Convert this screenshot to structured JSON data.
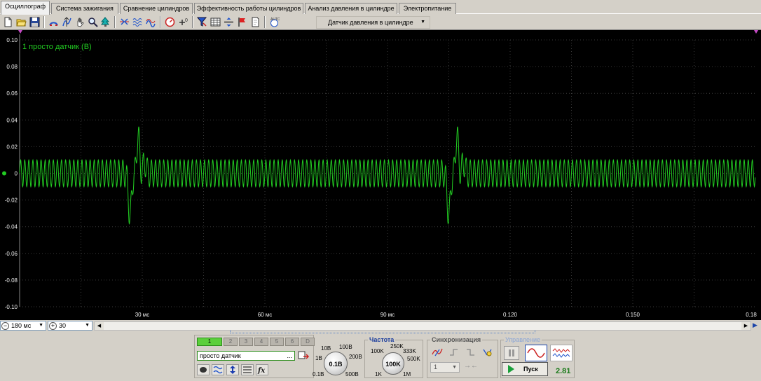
{
  "tabs": [
    {
      "label": "Осциллограф",
      "active": true
    },
    {
      "label": "Система зажигания",
      "active": false
    },
    {
      "label": "Сравнение цилиндров",
      "active": false
    },
    {
      "label": "Эффективность работы цилиндров",
      "active": false
    },
    {
      "label": "Анализ давления в цилиндре",
      "active": false
    },
    {
      "label": "Электропитание",
      "active": false
    }
  ],
  "toolbar": {
    "icons": [
      "new-file-icon",
      "open-folder-icon",
      "save-icon",
      "rotate-icon",
      "timing-icon",
      "hand-icon",
      "zoom-icon",
      "trigger-tree-icon",
      "markers-icon",
      "overlay-waves-icon",
      "waves-multi-icon",
      "gauge-auto-icon",
      "offset-zero-icon",
      "filter-icon",
      "table-icon",
      "divide-icon",
      "flag-icon",
      "note-icon",
      "auto-icon"
    ],
    "sensor_select": "Датчик давления в цилиндре"
  },
  "chart_data": {
    "type": "line",
    "series": [
      {
        "name": "1 просто датчик (В)",
        "color": "#22cc22"
      }
    ],
    "ylim": [
      -0.1,
      0.1
    ],
    "yticks": [
      "0.10",
      "0.08",
      "0.06",
      "0.04",
      "0.02",
      "0",
      "-0.02",
      "-0.04",
      "-0.06",
      "-0.08",
      "-0.10"
    ],
    "xlim_ms": [
      0,
      180
    ],
    "xticks": [
      "30 мс",
      "60 мс",
      "90 мс",
      "0.120",
      "0.150",
      "0.18"
    ],
    "xtick_values_ms": [
      30,
      60,
      90,
      120,
      150,
      180
    ],
    "description_values": {
      "baseline_amplitude": 0.01,
      "baseline_period_ms": 1.0,
      "event_times_ms": [
        28,
        106
      ],
      "event_peak": 0.036,
      "event_trough": -0.038
    }
  },
  "status": {
    "timebase": "180 мс",
    "samples": "30"
  },
  "channels": {
    "buttons": [
      "1",
      "2",
      "3",
      "4",
      "5",
      "6",
      "D"
    ],
    "active": "1",
    "name_value": "просто датчик",
    "name_more": "..."
  },
  "volt_knob": {
    "value": "0.1В",
    "labels": [
      "10В",
      "100В",
      "1В",
      "200В",
      "0.1В",
      "500В"
    ]
  },
  "freq_panel": {
    "title": "Частота",
    "value": "100K",
    "labels": [
      "250K",
      "100K",
      "333K",
      "500K",
      "1K",
      "1M"
    ]
  },
  "sync_panel": {
    "title": "Синхронизация",
    "channel": "1"
  },
  "control_panel": {
    "title": "Управление",
    "start_label": "Пуск",
    "readout": "2.81"
  },
  "colors": {
    "trace": "#22cc22",
    "grid": "#3a3a3a",
    "axis_text": "#f0f0f0",
    "title_text": "#22cc22",
    "readout": "#1a7a1a"
  }
}
